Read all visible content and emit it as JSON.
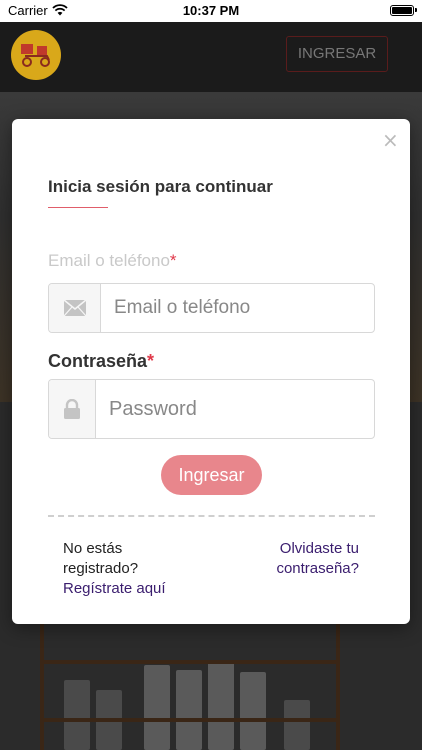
{
  "status_bar": {
    "carrier": "Carrier",
    "time": "10:37 PM"
  },
  "header": {
    "login_button": "INGRESAR"
  },
  "modal": {
    "close_glyph": "×",
    "title": "Inicia sesión para continuar",
    "email": {
      "label": "Email o teléfono",
      "required_mark": "*",
      "placeholder": "Email o teléfono",
      "value": ""
    },
    "password": {
      "label": "Contraseña",
      "required_mark": "*",
      "placeholder": "Password",
      "value": ""
    },
    "submit_label": "Ingresar",
    "no_account_text": "No estás registrado?",
    "register_link": "Regístrate aquí",
    "forgot_link": "Olvidaste tu contraseña?"
  },
  "colors": {
    "accent": "#e8868c",
    "required": "#e0394a",
    "link": "#3a1d6e",
    "logo": "#d9a81a"
  },
  "icons": {
    "email_icon": "envelope-icon",
    "password_icon": "lock-icon"
  }
}
